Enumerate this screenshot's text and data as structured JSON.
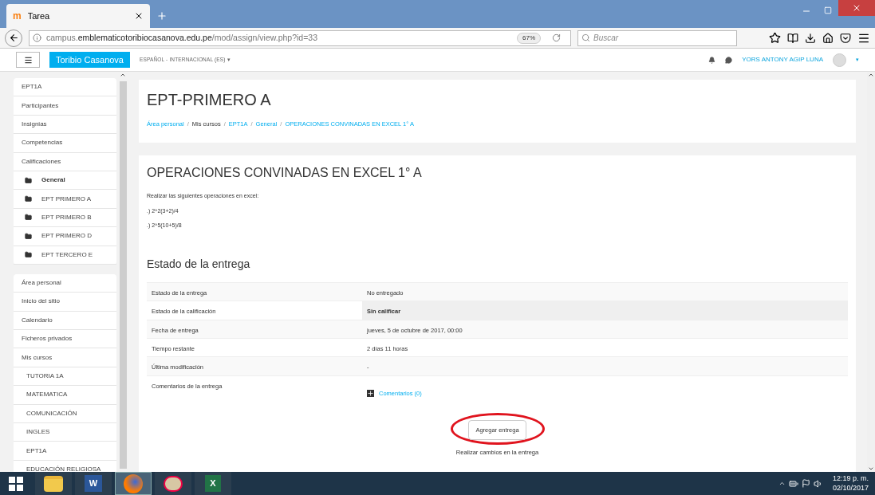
{
  "browser": {
    "tab": {
      "title": "Tarea",
      "logo": "m"
    },
    "url": "campus.**emblematicotoribiocasanova.edu.pe**/mod/assign/view.php?id=33",
    "zoom": "67%",
    "search": {
      "placeholder": "Buscar"
    }
  },
  "navbar": {
    "brand": "Toribio Casanova",
    "language": "ESPAÑOL - INTERNACIONAL (ES)",
    "language_caret": "▾",
    "user": "YORS ANTONY AGIP LUNA",
    "user_caret": "▾"
  },
  "sidebar": {
    "blocks": [
      [
        {
          "label": "EPT1A",
          "kind": "link",
          "selected": false
        },
        {
          "label": "Participantes",
          "kind": "link",
          "selected": false
        },
        {
          "label": "Insignias",
          "kind": "link",
          "selected": false
        },
        {
          "label": "Competencias",
          "kind": "link",
          "selected": false
        },
        {
          "label": "Calificaciones",
          "kind": "link",
          "selected": false
        },
        {
          "label": "General",
          "kind": "folder",
          "selected": true
        },
        {
          "label": "EPT PRIMERO A",
          "kind": "folder",
          "selected": false
        },
        {
          "label": "EPT PRIMERO B",
          "kind": "folder",
          "selected": false
        },
        {
          "label": "EPT PRIMERO D",
          "kind": "folder",
          "selected": false
        },
        {
          "label": "EPT TERCERO E",
          "kind": "folder",
          "selected": false
        }
      ],
      [
        {
          "label": "Área personal",
          "kind": "link",
          "selected": false
        },
        {
          "label": "Inicio del sitio",
          "kind": "link",
          "selected": false
        },
        {
          "label": "Calendario",
          "kind": "link",
          "selected": false
        },
        {
          "label": "Ficheros privados",
          "kind": "link",
          "selected": false
        },
        {
          "label": "Mis cursos",
          "kind": "link",
          "selected": false,
          "children": [
            {
              "label": "TUTORIA 1A",
              "selected": false
            },
            {
              "label": "MATEMATICA",
              "selected": false
            },
            {
              "label": "COMUNICACIÓN",
              "selected": false
            },
            {
              "label": "INGLES",
              "selected": false
            },
            {
              "label": "EPT1A",
              "selected": false
            },
            {
              "label": "EDUCACIÓN RELIGIOSA",
              "selected": false
            }
          ]
        }
      ]
    ]
  },
  "header": {
    "title": "EPT-PRIMERO A",
    "separator": "/",
    "breadcrumb": [
      {
        "label": "Área personal",
        "link": true
      },
      {
        "label": "Mis cursos",
        "link": false
      },
      {
        "label": "EPT1A",
        "link": true
      },
      {
        "label": "General",
        "link": true
      },
      {
        "label": "OPERACIONES CONVINADAS EN EXCEL 1° A",
        "link": true
      }
    ]
  },
  "assignment": {
    "title": "OPERACIONES CONVINADAS EN EXCEL 1° A",
    "paragraphs": [
      "Realizar las siguientes operaciones en excel:",
      ".) 2^2(3+2)/4",
      ".) 2^5(10+5)/8"
    ],
    "status_heading": "Estado de la entrega",
    "rows": [
      {
        "label": "Estado de la entrega",
        "value": "No entregado"
      },
      {
        "label": "Estado de la calificación",
        "value": "Sin calificar",
        "emphasis": true
      },
      {
        "label": "Fecha de entrega",
        "value": "jueves, 5 de octubre de 2017, 00:00"
      },
      {
        "label": "Tiempo restante",
        "value": "2 días 11 horas"
      },
      {
        "label": "Última modificación",
        "value": "-"
      },
      {
        "label": "Comentarios de la entrega",
        "value": "Comentarios (0)",
        "kind": "comments"
      }
    ],
    "button": "Agregar entrega",
    "button_circled": true,
    "hint": "Realizar cambios en la entrega"
  },
  "taskbar": {
    "apps": [
      {
        "kind": "explorer",
        "active": false
      },
      {
        "kind": "word",
        "letter": "W",
        "active": false
      },
      {
        "kind": "firefox",
        "active": true
      },
      {
        "kind": "paint",
        "active": false
      },
      {
        "kind": "excel",
        "letter": "X",
        "active": false
      }
    ],
    "time": "12:19 p. m.",
    "date": "02/10/2017"
  }
}
